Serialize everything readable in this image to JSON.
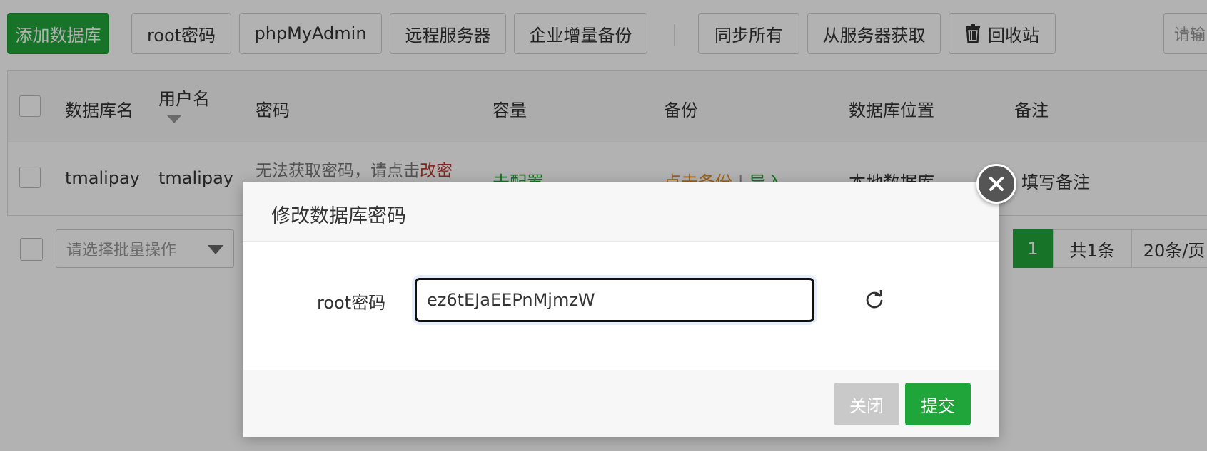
{
  "toolbar": {
    "add_db": "添加数据库",
    "root_pwd": "root密码",
    "phpmyadmin": "phpMyAdmin",
    "remote_server": "远程服务器",
    "enterprise_backup": "企业增量备份",
    "sync_all": "同步所有",
    "fetch_from_server": "从服务器获取",
    "recycle_bin": "回收站",
    "search_placeholder": "请输"
  },
  "table": {
    "headers": {
      "db_name": "数据库名",
      "username": "用户名",
      "password": "密码",
      "capacity": "容量",
      "backup": "备份",
      "db_location": "数据库位置",
      "note": "备注"
    },
    "rows": [
      {
        "db_name": "tmalipay",
        "username": "tmalipay",
        "password_msg": "无法获取密码，请点击",
        "password_link": "改密",
        "capacity": "未配置",
        "backup_link": "点击备份",
        "backup_sep": "|",
        "import_link": "导入",
        "location": "本地数据库",
        "note": "填写备注"
      }
    ]
  },
  "footer": {
    "batch_placeholder": "请选择批量操作",
    "page_current": "1",
    "total": "共1条",
    "per_page": "20条/页"
  },
  "dialog": {
    "title": "修改数据库密码",
    "field_label": "root密码",
    "password_value": "ez6tEJaEEPnMjmzW",
    "close_btn": "关闭",
    "submit_btn": "提交"
  },
  "colors": {
    "accent_green": "#20a53a",
    "link_red": "#c0392b",
    "link_orange": "#e08a1e",
    "overlay": "rgba(0,0,0,0.3)"
  },
  "icons": {
    "trash": "trash-icon",
    "refresh": "refresh-icon",
    "close": "close-icon",
    "sort": "caret-down-icon"
  }
}
